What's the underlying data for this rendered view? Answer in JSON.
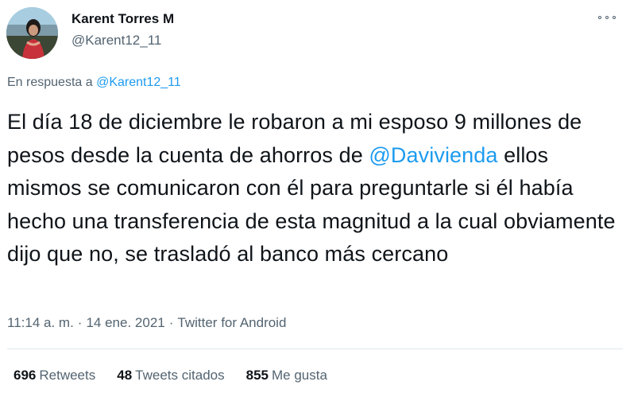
{
  "author": {
    "name": "Karent Torres M",
    "handle": "@Karent12_11"
  },
  "reply_context": {
    "prefix": "En respuesta a",
    "handle": "@Karent12_11"
  },
  "tweet": {
    "text_part1": "El día 18 de diciembre le robaron a mi esposo 9 millones de pesos desde la cuenta de ahorros de ",
    "mention": "@Davivienda",
    "text_part2": " ellos mismos se comunicaron con él para preguntarle si él había hecho una transferencia de esta magnitud a la cual obviamente dijo que no, se trasladó al banco más cercano"
  },
  "meta": {
    "time": "11:14 a. m.",
    "separator": "·",
    "date": "14 ene. 2021",
    "source": "Twitter for Android"
  },
  "stats": {
    "retweets_count": "696",
    "retweets_label": "Retweets",
    "quotes_count": "48",
    "quotes_label": "Tweets citados",
    "likes_count": "855",
    "likes_label": "Me gusta"
  },
  "colors": {
    "link": "#1d9bf0",
    "secondary_text": "#536471",
    "primary_text": "#0f1419"
  }
}
